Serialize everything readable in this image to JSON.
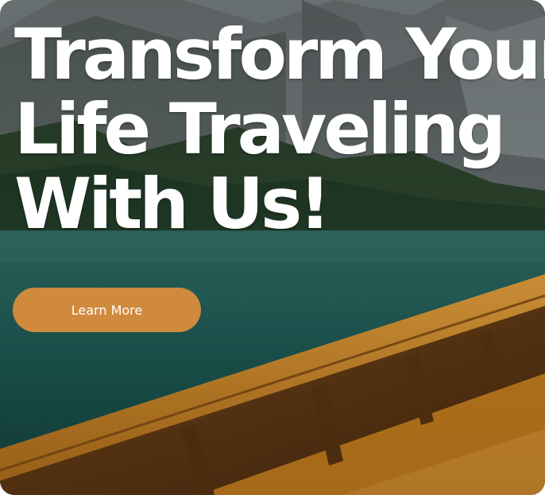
{
  "hero": {
    "headline_lines": [
      "Transform Your",
      "Life Traveling",
      "With Us!"
    ],
    "cta_label": "Learn More"
  },
  "colors": {
    "cta_background": "#d08a3e",
    "headline_text": "#ffffff",
    "lake_water": "#1f5e5a",
    "boat_wood": "#c07d22"
  },
  "background_image": {
    "depicts": [
      "mountain-cliffs",
      "forest",
      "lake",
      "wooden-boat"
    ]
  }
}
